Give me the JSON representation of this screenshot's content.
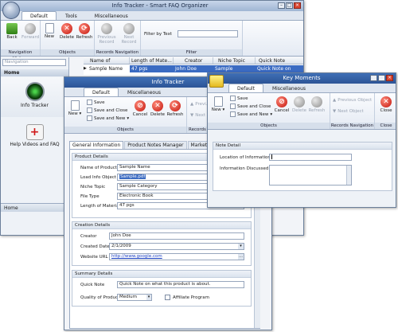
{
  "main": {
    "title": "Info Tracker - Smart FAQ Organizer",
    "tabs": [
      "Default",
      "Tools",
      "Miscellaneous"
    ],
    "ribbon": {
      "back": "Back",
      "forward": "Forward",
      "new": "New",
      "delete": "Delete",
      "refresh": "Refresh",
      "prev_record": "Previous Record",
      "next_record": "Next Record",
      "filter_label": "Filter by Text",
      "groups": [
        "Navigation History",
        "Objects",
        "Records Navigation",
        "Filter"
      ]
    },
    "nav_placeholder": "Navigation",
    "sidebar": {
      "home": "Home",
      "items": [
        "Info Tracker",
        "Help Videos and FAQ"
      ],
      "footer": "Home"
    },
    "table": {
      "columns": [
        "Name of Product",
        "Length of Mate...",
        "Creator",
        "Niche Topic",
        "Quick Note"
      ],
      "row": [
        "Sample Name",
        "47 pgs",
        "John Doe",
        "Sample Category",
        "Quick Note on wh..."
      ]
    }
  },
  "tracker": {
    "title": "Info Tracker",
    "tabs": [
      "Default",
      "Miscellaneous"
    ],
    "ribbon": {
      "new": "New",
      "save": "Save",
      "save_close": "Save and Close",
      "save_new": "Save and New",
      "cancel": "Cancel",
      "delete": "Delete",
      "refresh": "Refresh",
      "prev": "Previ...",
      "next": "Next",
      "groups": [
        "Objects",
        "Records N"
      ]
    },
    "form_tabs": [
      "General Information",
      "Product Notes Manager",
      "Marketing Details"
    ],
    "product_details": {
      "header": "Product Details",
      "name_label": "Name of Product",
      "name": "Sample Name",
      "load_label": "Load Info Object",
      "load": "Sample.pdf",
      "niche_label": "Niche Topic",
      "niche": "Sample Category",
      "filetype_label": "File Type",
      "filetype": "Electronic Book",
      "length_label": "Length of Material",
      "length": "47 pgs"
    },
    "creation_details": {
      "header": "Creation Details",
      "creator_label": "Creator",
      "creator": "John Doe",
      "created_label": "Created Date",
      "created": "2/1/2009",
      "url_label": "Website URL",
      "url": "http://www.google.com"
    },
    "summary_details": {
      "header": "Summary Details",
      "quicknote_label": "Quick Note",
      "quicknote": "Quick Note on what this product is about.",
      "quality_label": "Quality of Product",
      "quality": "Medium",
      "affiliate_label": "Affiliate Program"
    }
  },
  "moments": {
    "title": "Key Moments",
    "tabs": [
      "Default",
      "Miscellaneous"
    ],
    "ribbon": {
      "new": "New",
      "save": "Save",
      "save_close": "Save and Close",
      "save_new": "Save and New",
      "cancel": "Cancel",
      "delete": "Delete",
      "refresh": "Refresh",
      "prev": "Previous Object",
      "next": "Next Object",
      "close": "Close",
      "groups": [
        "Objects",
        "Records Navigation",
        "Close"
      ]
    },
    "note": {
      "header": "Note Detail",
      "location_label": "Location of Information",
      "discussed_label": "Information Discussed"
    }
  }
}
